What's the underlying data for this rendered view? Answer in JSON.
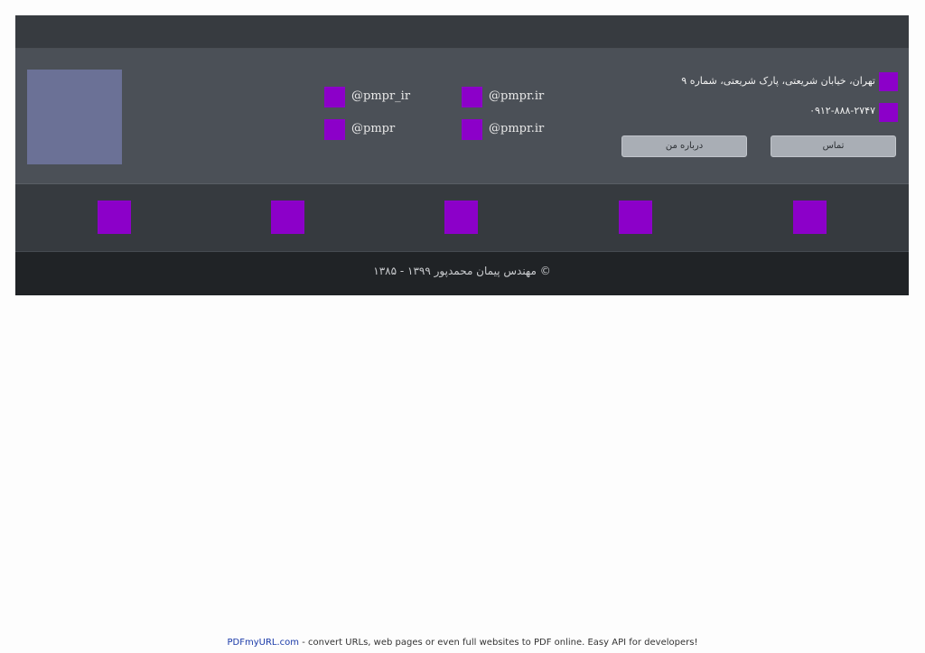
{
  "header": {},
  "contact": {
    "address": "تهران، خیابان شریعتی، پارک شریعتی، شماره ۹",
    "phone": "۰۹۱۲-۸۸۸-۲۷۴۷",
    "social": [
      {
        "handle": "@pmpr.ir",
        "icon": "social-icon"
      },
      {
        "handle": "@pmpr_ir",
        "icon": "social-icon"
      },
      {
        "handle": "@pmpr.ir",
        "icon": "social-icon"
      },
      {
        "handle": "@pmpr",
        "icon": "social-icon"
      }
    ],
    "buttons": {
      "contact_label": "تماس",
      "about_label": "درباره من"
    }
  },
  "icon_row": {
    "icons": [
      "link-icon",
      "link-icon",
      "link-icon",
      "link-icon",
      "link-icon"
    ]
  },
  "footer": {
    "copyright": "© مهندس پیمان محمدپور   ۱۳۹۹ - ۱۳۸۵"
  },
  "credit": {
    "link_text": "PDFmyURL.com",
    "text": " - convert URLs, web pages or even full websites to PDF online. Easy API for developers!"
  },
  "colors": {
    "accent": "#8c00c9",
    "photo_placeholder": "#6b7196",
    "button": "#a9aeb5"
  }
}
